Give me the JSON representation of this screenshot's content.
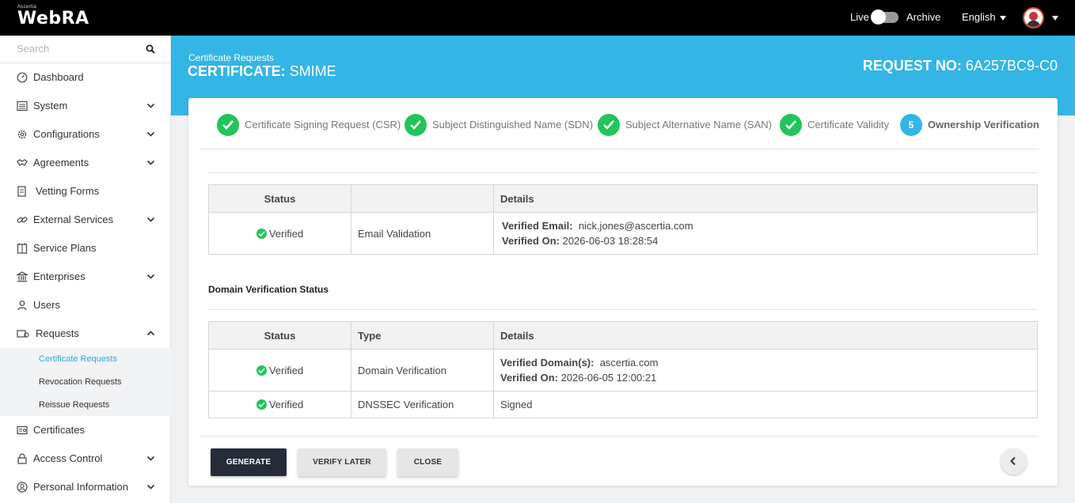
{
  "app": {
    "brand_small": "Ascertia",
    "brand_main": "WebRA"
  },
  "topbar": {
    "live_label": "Live",
    "archive_label": "Archive",
    "language": "English"
  },
  "sidebar": {
    "search_placeholder": "Search",
    "items": [
      {
        "label": "Dashboard",
        "icon": "dashboard-icon",
        "expandable": false
      },
      {
        "label": "System",
        "icon": "system-icon",
        "expandable": true
      },
      {
        "label": "Configurations",
        "icon": "gear-icon",
        "expandable": true
      },
      {
        "label": "Agreements",
        "icon": "handshake-icon",
        "expandable": true
      },
      {
        "label": "Vetting Forms",
        "icon": "form-icon",
        "expandable": false
      },
      {
        "label": "External Services",
        "icon": "link-icon",
        "expandable": true
      },
      {
        "label": "Service Plans",
        "icon": "plans-icon",
        "expandable": false
      },
      {
        "label": "Enterprises",
        "icon": "bank-icon",
        "expandable": true
      },
      {
        "label": "Users",
        "icon": "user-icon",
        "expandable": false
      },
      {
        "label": "Requests",
        "icon": "requests-icon",
        "expandable": true,
        "expanded": true
      },
      {
        "label": "Certificates",
        "icon": "certificate-icon",
        "expandable": false
      },
      {
        "label": "Access Control",
        "icon": "lock-icon",
        "expandable": true
      },
      {
        "label": "Personal Information",
        "icon": "person-circle-icon",
        "expandable": true
      }
    ],
    "sub_items": [
      {
        "label": "Certificate Requests",
        "active": true
      },
      {
        "label": "Revocation Requests",
        "active": false
      },
      {
        "label": "Reissue Requests",
        "active": false
      }
    ]
  },
  "header": {
    "breadcrumb": "Certificate Requests",
    "title_prefix": "CERTIFICATE:",
    "title_value": "SMIME",
    "request_prefix": "REQUEST NO:",
    "request_value": "6A257BC9-C0"
  },
  "steps": [
    {
      "label": "Certificate Signing Request (CSR)",
      "status": "done"
    },
    {
      "label": "Subject Distinguished Name (SDN)",
      "status": "done"
    },
    {
      "label": "Subject Alternative Name (SAN)",
      "status": "done"
    },
    {
      "label": "Certificate Validity",
      "status": "done"
    },
    {
      "label": "Ownership Verification",
      "status": "current",
      "number": "5"
    }
  ],
  "email_table": {
    "headers": [
      "Status",
      "",
      "Details"
    ],
    "rows": [
      {
        "status": "Verified",
        "type": "Email Validation",
        "detail1_label": "Verified Email:",
        "detail1_value": "nick.jones@ascertia.com",
        "detail2_label": "Verified On:",
        "detail2_value": "2026-06-03 18:28:54"
      }
    ]
  },
  "domain_section_title": "Domain Verification Status",
  "domain_table": {
    "headers": [
      "Status",
      "Type",
      "Details"
    ],
    "rows": [
      {
        "status": "Verified",
        "type": "Domain Verification",
        "detail1_label": "Verified Domain(s):",
        "detail1_value": "ascertia.com",
        "detail2_label": "Verified On:",
        "detail2_value": "2026-06-05 12:00:21"
      },
      {
        "status": "Verified",
        "type": "DNSSEC Verification",
        "detail_text": "Signed"
      }
    ]
  },
  "buttons": {
    "generate": "GENERATE",
    "verify_later": "VERIFY LATER",
    "close": "CLOSE"
  },
  "colors": {
    "banner": "#33b5e5",
    "success": "#21c55a",
    "primary_button": "#252b39",
    "active_link": "#2ea8dc"
  }
}
